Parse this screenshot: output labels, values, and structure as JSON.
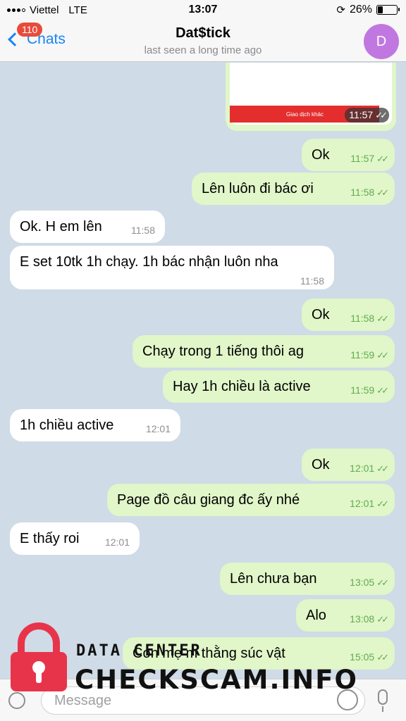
{
  "status_bar": {
    "carrier": "Viettel",
    "network": "LTE",
    "time": "13:07",
    "battery_percent": "26%",
    "battery_level": 0.26
  },
  "header": {
    "back_label": "Chats",
    "unread_badge": "110",
    "title": "Dat$tick",
    "subtitle": "last seen a long time ago",
    "avatar_initial": "D"
  },
  "image_message": {
    "button_text": "Giao dịch khác",
    "time": "11:57"
  },
  "messages": [
    {
      "dir": "out",
      "text": "Ok",
      "time": "11:57"
    },
    {
      "dir": "out",
      "text": "Lên luôn đi bác ơi",
      "time": "11:58"
    },
    {
      "dir": "in",
      "text": "Ok. H em lên",
      "time": "11:58"
    },
    {
      "dir": "in",
      "text": "E set 10tk 1h chạy. 1h bác nhận  luôn nha",
      "time": "11:58"
    },
    {
      "dir": "out",
      "text": "Ok",
      "time": "11:58"
    },
    {
      "dir": "out",
      "text": "Chạy trong 1 tiếng thôi ag",
      "time": "11:59"
    },
    {
      "dir": "out",
      "text": "Hay 1h chiều là active",
      "time": "11:59"
    },
    {
      "dir": "in",
      "text": "1h chiều active",
      "time": "12:01"
    },
    {
      "dir": "out",
      "text": "Ok",
      "time": "12:01"
    },
    {
      "dir": "out",
      "text": "Page đồ câu giang đc ấy nhé",
      "time": "12:01"
    },
    {
      "dir": "in",
      "text": "E thấy roi",
      "time": "12:01"
    },
    {
      "dir": "out",
      "text": "Lên chưa bạn",
      "time": "13:05"
    },
    {
      "dir": "out",
      "text": "Alo",
      "time": "13:08"
    },
    {
      "dir": "out",
      "text": "Con mẹ m thằng súc vật",
      "time": "15:05"
    }
  ],
  "input": {
    "placeholder": "Message"
  },
  "watermark": {
    "line1": "DATA CENTER",
    "line2": "CHECKSCAM.INFO",
    "color": "#e8344a"
  },
  "colors": {
    "accent": "#1a84f2",
    "outgoing_bubble": "#e1f6c9",
    "incoming_bubble": "#ffffff",
    "read_ticks": "#5fad50",
    "avatar": "#c078e0",
    "badge": "#e84b3a"
  }
}
